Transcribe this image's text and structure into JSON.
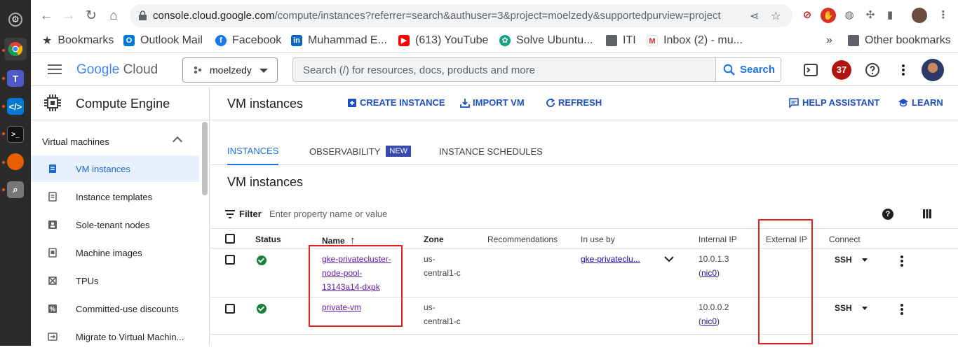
{
  "browser": {
    "url_host": "console.cloud.google.com",
    "url_rest": "/compute/instances?referrer=search&authuser=3&project=moelzedy&supportedpurview=project",
    "bookmarks": [
      {
        "label": "Bookmarks"
      },
      {
        "label": "Outlook Mail"
      },
      {
        "label": "Facebook"
      },
      {
        "label": "Muhammad E..."
      },
      {
        "label": "(613) YouTube"
      },
      {
        "label": "Solve Ubuntu..."
      },
      {
        "label": "ITI"
      },
      {
        "label": "Inbox (2) - mu..."
      }
    ],
    "more_bookmarks": "»",
    "other_bookmarks": "Other bookmarks"
  },
  "gc": {
    "logo_google": "Google",
    "logo_cloud": "Cloud",
    "project": "moelzedy",
    "search_placeholder": "Search (/) for resources, docs, products and more",
    "search_button": "Search",
    "notifications": "37"
  },
  "sidebar": {
    "product": "Compute Engine",
    "section": "Virtual machines",
    "items": [
      {
        "label": "VM instances"
      },
      {
        "label": "Instance templates"
      },
      {
        "label": "Sole-tenant nodes"
      },
      {
        "label": "Machine images"
      },
      {
        "label": "TPUs"
      },
      {
        "label": "Committed-use discounts"
      },
      {
        "label": "Migrate to Virtual Machin..."
      }
    ]
  },
  "main": {
    "title": "VM instances",
    "actions": {
      "create": "CREATE INSTANCE",
      "import": "IMPORT VM",
      "refresh": "REFRESH",
      "help": "HELP ASSISTANT",
      "learn": "LEARN"
    },
    "tabs": [
      {
        "label": "INSTANCES"
      },
      {
        "label": "OBSERVABILITY"
      },
      {
        "label": "INSTANCE SCHEDULES"
      }
    ],
    "new_badge": "NEW",
    "subtitle": "VM instances",
    "filter_label": "Filter",
    "filter_placeholder": "Enter property name or value",
    "help_glyph": "?"
  },
  "table": {
    "headers": {
      "status": "Status",
      "name": "Name",
      "sort_arrow": "↑",
      "zone": "Zone",
      "recommendations": "Recommendations",
      "in_use_by": "In use by",
      "internal_ip": "Internal IP",
      "external_ip": "External IP",
      "connect": "Connect"
    },
    "rows": [
      {
        "name_lines": [
          "gke-privatecluster-",
          "node-pool-",
          "13143a14-dxpk"
        ],
        "zone_lines": [
          "us-",
          "central1-c"
        ],
        "in_use_by": "gke-privateclu...",
        "internal_ip": "10.0.1.3",
        "nic": "nic0",
        "connect": "SSH"
      },
      {
        "name_lines": [
          "private-vm"
        ],
        "zone_lines": [
          "us-",
          "central1-c"
        ],
        "in_use_by": "",
        "internal_ip": "10.0.0.2",
        "nic": "nic0",
        "connect": "SSH"
      }
    ]
  },
  "colors": {
    "accent_blue": "#1a73e8",
    "status_green": "#188038",
    "annotation_red": "#e02020",
    "badge_red": "#b31412"
  }
}
